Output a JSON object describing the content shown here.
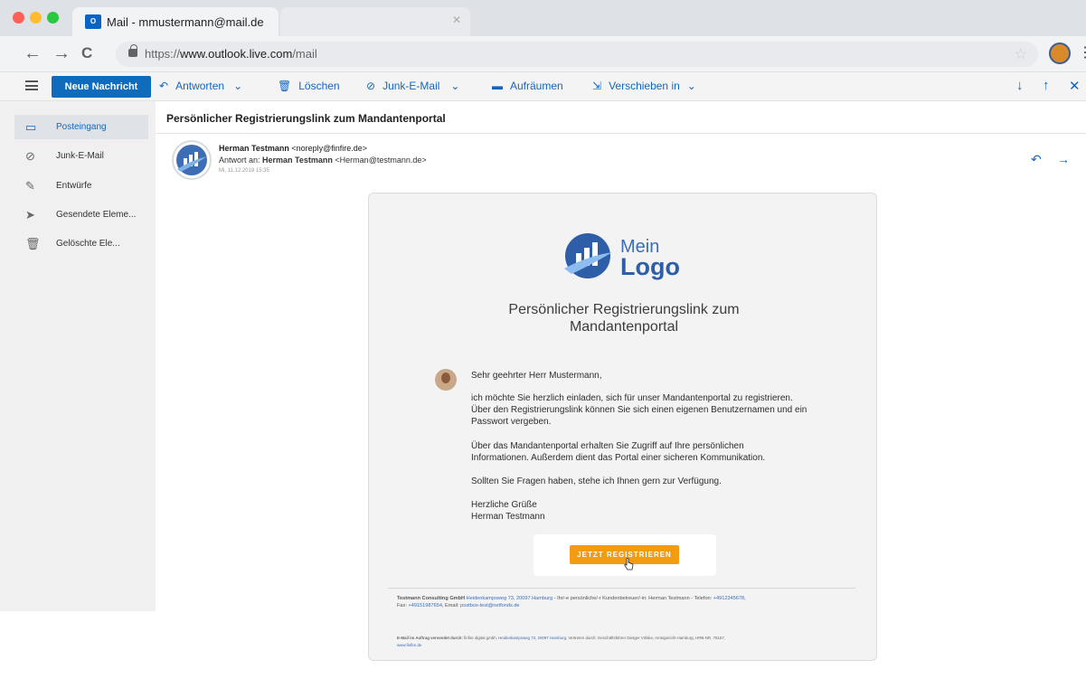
{
  "browser": {
    "tab_title": "Mail - mmustermann@mail.de",
    "tab_icon_text": "O",
    "url_prefix": "https://",
    "url_host": "www.outlook.live.com",
    "url_path": "/mail",
    "back_glyph": "←",
    "forward_glyph": "→",
    "reload_glyph": "C",
    "star_glyph": "☆",
    "menu_glyph": "⋮",
    "close_tab_glyph": "✕"
  },
  "toolbar": {
    "new_message": "Neue Nachricht",
    "reply": "Antworten",
    "delete": "Löschen",
    "junk": "Junk-E-Mail",
    "sweep": "Aufräumen",
    "move": "Verschieben in",
    "chev": "⌄",
    "icons": {
      "reply": "↶",
      "delete": "🗑",
      "junk": "⊘",
      "sweep": "▬",
      "move": "⇲",
      "down": "↓",
      "up": "↑",
      "close": "✕"
    }
  },
  "sidebar": {
    "items": [
      {
        "label": "Posteingang",
        "icon": "▭"
      },
      {
        "label": "Junk-E-Mail",
        "icon": "⊘"
      },
      {
        "label": "Entwürfe",
        "icon": "✎"
      },
      {
        "label": "Gesendete Eleme...",
        "icon": "➤"
      },
      {
        "label": "Gelöschte Ele...",
        "icon": "🗑"
      }
    ]
  },
  "email": {
    "subject": "Persönlicher Registrierungslink zum Mandantenportal",
    "sender_name": "Herman Testmann",
    "sender_addr": "<noreply@finfire.de>",
    "reply_to_label": "Antwort an:",
    "reply_to_name": "Herman Testmann",
    "reply_to_addr": "<Herman@testmann.de>",
    "date": "Mi, 11.12.2019 15:35",
    "actions": {
      "reply": "↶",
      "forward": "→"
    }
  },
  "body": {
    "logo_mein": "Mein",
    "logo_logo": "Logo",
    "heading": "Persönlicher Registrierungslink zum Mandantenportal",
    "greeting": "Sehr geehrter Herr Mustermann,",
    "p1_l1": "ich möchte Sie herzlich einladen, sich für unser Mandantenportal zu registrieren.",
    "p1_l2": "Über den Registrierungslink können Sie sich einen eigenen Benutzernamen und ein",
    "p1_l3": "Passwort vergeben.",
    "p2_l1": "Über das Mandantenportal erhalten Sie Zugriff auf Ihre persönlichen",
    "p2_l2": "Informationen. Außerdem dient das Portal einer sicheren Kommunikation.",
    "p3": "Sollten Sie Fragen haben, stehe ich Ihnen gern zur Verfügung.",
    "closing": "Herzliche Grüße",
    "signature": "Herman Testmann",
    "cta": "JETZT REGISTRIEREN"
  },
  "footer": {
    "company": "Testmann Consulting GmbH",
    "address": "Heidenkampsweg 73, 20097 Hamburg",
    "advisor_text": " - Ihr/-e persönliche/-r Kundenbetreuer/-in: Herman Testmann - Telefon: ",
    "phone": "+4912345678",
    "fax_label": "Fax: ",
    "fax": "+49151987654",
    "email_label": ", Email: ",
    "email": "postbox-test@netfonds.de",
    "sent_label": "E-Mail im Auftrag versendet durch:",
    "sent_text": " finfire digital gmbh, ",
    "sent_address": "Heidenkampsweg 73, 20097 Hamburg",
    "sent_rest": ", Vertreten durch: Geschäftsführer Dietger Völske, Amtsgericht Hamburg, HRB-NR. 78167,",
    "website": "www.finfire.de"
  },
  "colors": {
    "accent": "#1266c2",
    "primary_button": "#0f6cbd",
    "cta": "#f39c12",
    "logo_blue": "#2e5ea8"
  }
}
